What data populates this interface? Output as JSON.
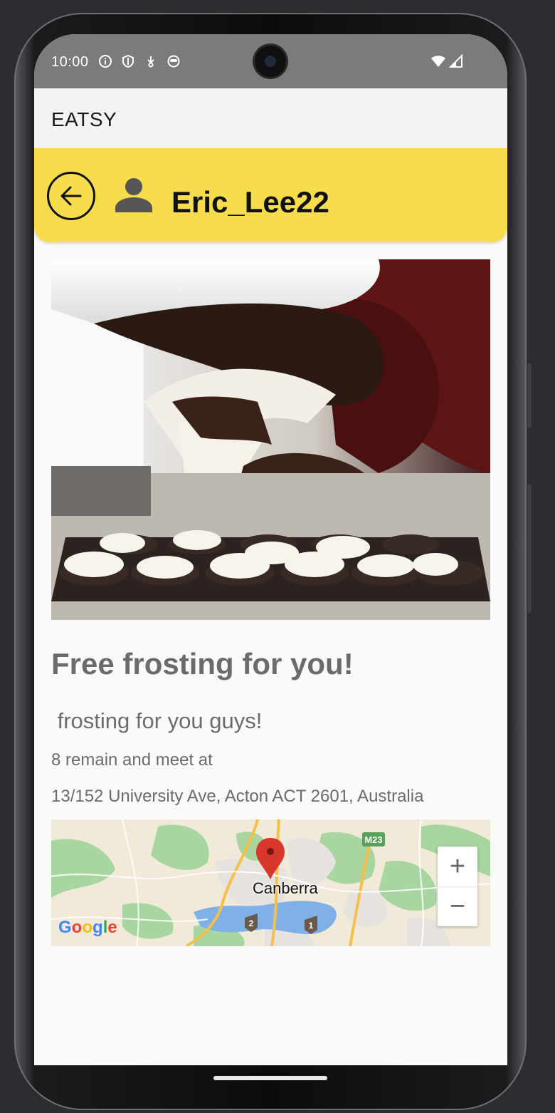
{
  "status_bar": {
    "time": "10:00",
    "left_icons": [
      "info-icon",
      "shield-icon",
      "download-icon",
      "face-icon"
    ],
    "right_icons": [
      "wifi-icon",
      "signal-icon"
    ]
  },
  "app_bar": {
    "title": "EATSY"
  },
  "user_header": {
    "username": "Eric_Lee22",
    "back_icon": "arrow-left-icon",
    "user_icon": "person-icon"
  },
  "post": {
    "image": "chef-piping-frosting-onto-cupcakes-photo",
    "title": "Free frosting for you!",
    "description": " frosting for you guys!",
    "remain_text": "8 remain and meet at",
    "address": "13/152 University Ave, Acton ACT 2601, Australia"
  },
  "map": {
    "city_label": "Canberra",
    "route_labels": [
      "M23",
      "2",
      "1"
    ],
    "zoom_in": "+",
    "zoom_out": "−",
    "logo": [
      "G",
      "o",
      "o",
      "g",
      "l",
      "e"
    ],
    "logo_colors": [
      "#4285F4",
      "#EA4335",
      "#FBBC05",
      "#4285F4",
      "#34A853",
      "#EA4335"
    ]
  },
  "colors": {
    "header_yellow": "#f7dd4b",
    "text_gray": "#6b6b6b",
    "pin_red": "#d8372b"
  }
}
